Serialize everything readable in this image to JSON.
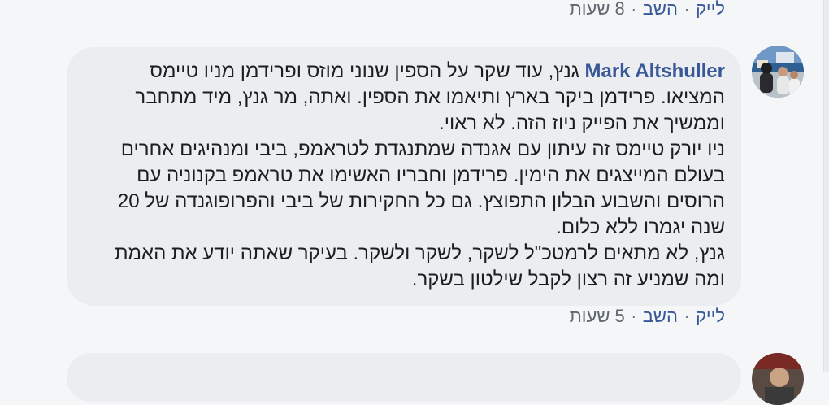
{
  "actions": {
    "like_label": "לייק",
    "reply_label": "השב",
    "separator": "·"
  },
  "comments": [
    {
      "time": "8 שעות"
    },
    {
      "author": "Mark Altshuller",
      "text": "גנץ, עוד שקר על הספין שנוני מוזס ופרידמן מניו טיימס המציאו. פרידמן ביקר בארץ ותיאמו את הספין. ואתה, מר גנץ, מיד מתחבר וממשיך את הפייק ניוז הזה. לא ראוי.\nניו יורק טיימס זה עיתון עם אגנדה שמתנגדת לטראמפ, ביבי ומנהיגים אחרים בעולם המייצגים את הימין. פרידמן וחבריו האשימו את טראמפ בקנוניה עם הרוסים והשבוע הבלון התפוצץ. גם כל החקירות של ביבי והפרופוגנדה של 20 שנה יגמרו ללא כלום.\nגנץ, לא מתאים לרמטכ\"ל לשקר, לשקר ולשקר. בעיקר שאתה יודע את האמת ומה שמניע זה רצון לקבל שילטון בשקר.",
      "time": "5 שעות"
    },
    {
      "author": "",
      "text": ""
    }
  ],
  "colors": {
    "link": "#385898",
    "bubble": "#ebedf0",
    "meta": "#606770"
  }
}
